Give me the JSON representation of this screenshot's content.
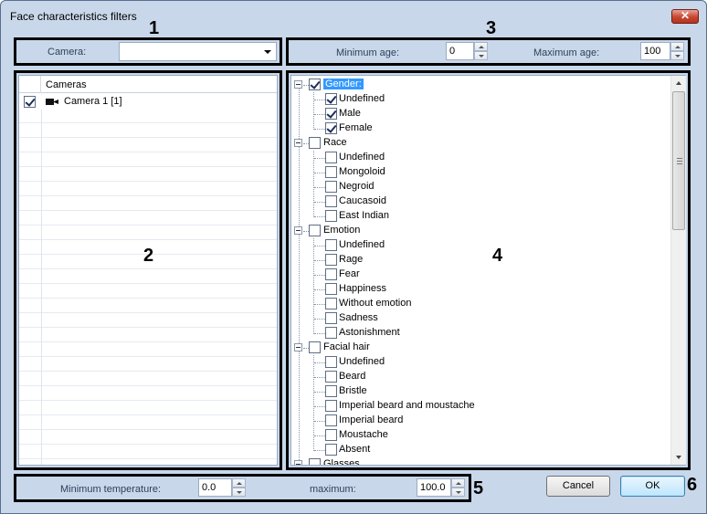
{
  "window": {
    "title": "Face characteristics filters",
    "close_label": "✕"
  },
  "markers": [
    "1",
    "2",
    "3",
    "4",
    "5",
    "6"
  ],
  "camera_filter": {
    "label": "Camera:",
    "selected": ""
  },
  "age_filter": {
    "min_label": "Minimum age:",
    "min_value": "0",
    "max_label": "Maximum age:",
    "max_value": "100"
  },
  "cameras_grid": {
    "header": "Cameras",
    "rows": [
      {
        "checked": true,
        "name": "Camera 1 [1]"
      }
    ]
  },
  "tree": {
    "groups": [
      {
        "label": "Gender:",
        "checked": true,
        "selected": true,
        "items": [
          {
            "label": "Undefined",
            "checked": true
          },
          {
            "label": "Male",
            "checked": true
          },
          {
            "label": "Female",
            "checked": true
          }
        ]
      },
      {
        "label": "Race",
        "checked": false,
        "items": [
          {
            "label": "Undefined",
            "checked": false
          },
          {
            "label": "Mongoloid",
            "checked": false
          },
          {
            "label": "Negroid",
            "checked": false
          },
          {
            "label": "Caucasoid",
            "checked": false
          },
          {
            "label": "East Indian",
            "checked": false
          }
        ]
      },
      {
        "label": "Emotion",
        "checked": false,
        "items": [
          {
            "label": "Undefined",
            "checked": false
          },
          {
            "label": "Rage",
            "checked": false
          },
          {
            "label": "Fear",
            "checked": false
          },
          {
            "label": "Happiness",
            "checked": false
          },
          {
            "label": "Without emotion",
            "checked": false
          },
          {
            "label": "Sadness",
            "checked": false
          },
          {
            "label": "Astonishment",
            "checked": false
          }
        ]
      },
      {
        "label": "Facial hair",
        "checked": false,
        "items": [
          {
            "label": "Undefined",
            "checked": false
          },
          {
            "label": "Beard",
            "checked": false
          },
          {
            "label": "Bristle",
            "checked": false
          },
          {
            "label": "Imperial beard and moustache",
            "checked": false
          },
          {
            "label": "Imperial beard",
            "checked": false
          },
          {
            "label": "Moustache",
            "checked": false
          },
          {
            "label": "Absent",
            "checked": false
          }
        ]
      },
      {
        "label": "Glasses",
        "checked": false,
        "items": []
      }
    ]
  },
  "temperature_filter": {
    "min_label": "Minimum temperature:",
    "min_value": "0.0",
    "max_label": "maximum:",
    "max_value": "100.0"
  },
  "buttons": {
    "cancel": "Cancel",
    "ok": "OK"
  }
}
